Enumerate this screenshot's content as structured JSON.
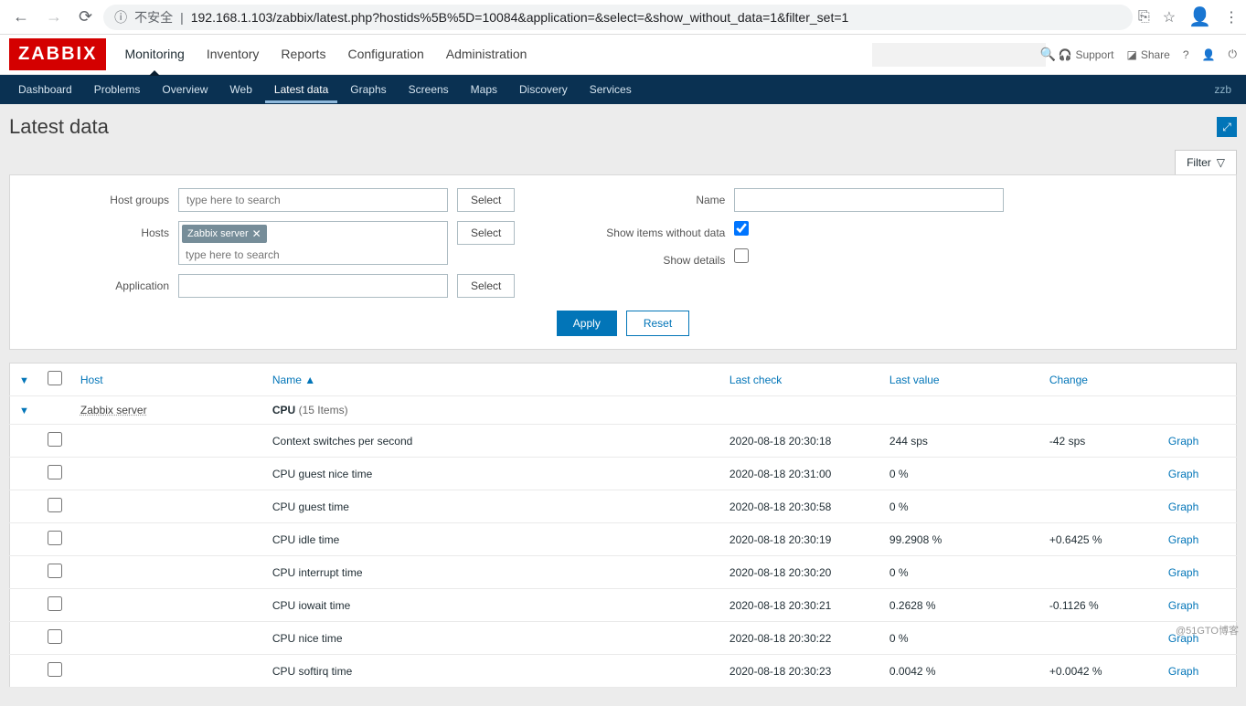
{
  "browser": {
    "insecure": "不安全",
    "url": "192.168.1.103/zabbix/latest.php?hostids%5B%5D=10084&application=&select=&show_without_data=1&filter_set=1"
  },
  "logo": "ZABBIX",
  "mainnav": [
    "Monitoring",
    "Inventory",
    "Reports",
    "Configuration",
    "Administration"
  ],
  "toplinks": {
    "support": "Support",
    "share": "Share"
  },
  "subnav": [
    "Dashboard",
    "Problems",
    "Overview",
    "Web",
    "Latest data",
    "Graphs",
    "Screens",
    "Maps",
    "Discovery",
    "Services"
  ],
  "user": "zzb",
  "page_title": "Latest data",
  "filter": {
    "tab": "Filter",
    "host_groups_label": "Host groups",
    "hosts_label": "Hosts",
    "application_label": "Application",
    "name_label": "Name",
    "show_without_label": "Show items without data",
    "show_details_label": "Show details",
    "placeholder": "type here to search",
    "select": "Select",
    "apply": "Apply",
    "reset": "Reset",
    "host_token": "Zabbix server",
    "show_without_data": true,
    "show_details": false
  },
  "columns": {
    "host": "Host",
    "name": "Name",
    "last_check": "Last check",
    "last_value": "Last value",
    "change": "Change"
  },
  "sort": "▲",
  "group": {
    "host": "Zabbix server",
    "app": "CPU",
    "count": "(15 Items)"
  },
  "graph_label": "Graph",
  "rows": [
    {
      "name": "Context switches per second",
      "last": "2020-08-18 20:30:18",
      "val": "244 sps",
      "chg": "-42 sps"
    },
    {
      "name": "CPU guest nice time",
      "last": "2020-08-18 20:31:00",
      "val": "0 %",
      "chg": ""
    },
    {
      "name": "CPU guest time",
      "last": "2020-08-18 20:30:58",
      "val": "0 %",
      "chg": ""
    },
    {
      "name": "CPU idle time",
      "last": "2020-08-18 20:30:19",
      "val": "99.2908 %",
      "chg": "+0.6425 %"
    },
    {
      "name": "CPU interrupt time",
      "last": "2020-08-18 20:30:20",
      "val": "0 %",
      "chg": ""
    },
    {
      "name": "CPU iowait time",
      "last": "2020-08-18 20:30:21",
      "val": "0.2628 %",
      "chg": "-0.1126 %"
    },
    {
      "name": "CPU nice time",
      "last": "2020-08-18 20:30:22",
      "val": "0 %",
      "chg": ""
    },
    {
      "name": "CPU softirq time",
      "last": "2020-08-18 20:30:23",
      "val": "0.0042 %",
      "chg": "+0.0042 %"
    }
  ],
  "watermark": "@51GTO博客"
}
